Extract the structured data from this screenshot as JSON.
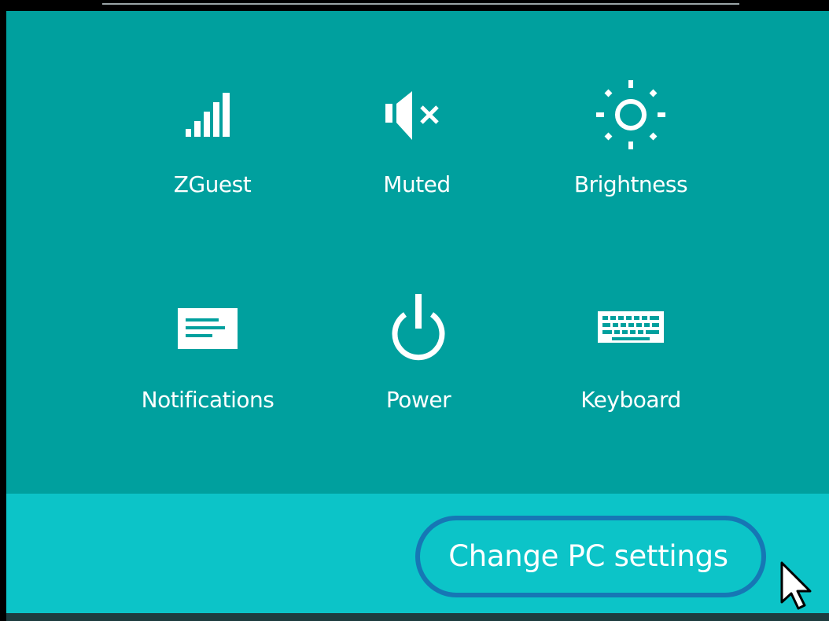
{
  "quick_settings": {
    "network": {
      "label": "ZGuest",
      "icon": "wifi-signal-icon"
    },
    "volume": {
      "label": "Muted",
      "icon": "speaker-muted-icon"
    },
    "brightness": {
      "label": "Brightness",
      "icon": "sun-icon"
    },
    "notifications": {
      "label": "Notifications",
      "icon": "notification-icon"
    },
    "power": {
      "label": "Power",
      "icon": "power-icon"
    },
    "keyboard": {
      "label": "Keyboard",
      "icon": "keyboard-icon"
    }
  },
  "footer": {
    "change_pc_settings": "Change PC settings"
  },
  "colors": {
    "panel": "#00a09e",
    "footer": "#0cc4c8",
    "highlight_ring": "#1677b5",
    "text": "#ffffff"
  }
}
